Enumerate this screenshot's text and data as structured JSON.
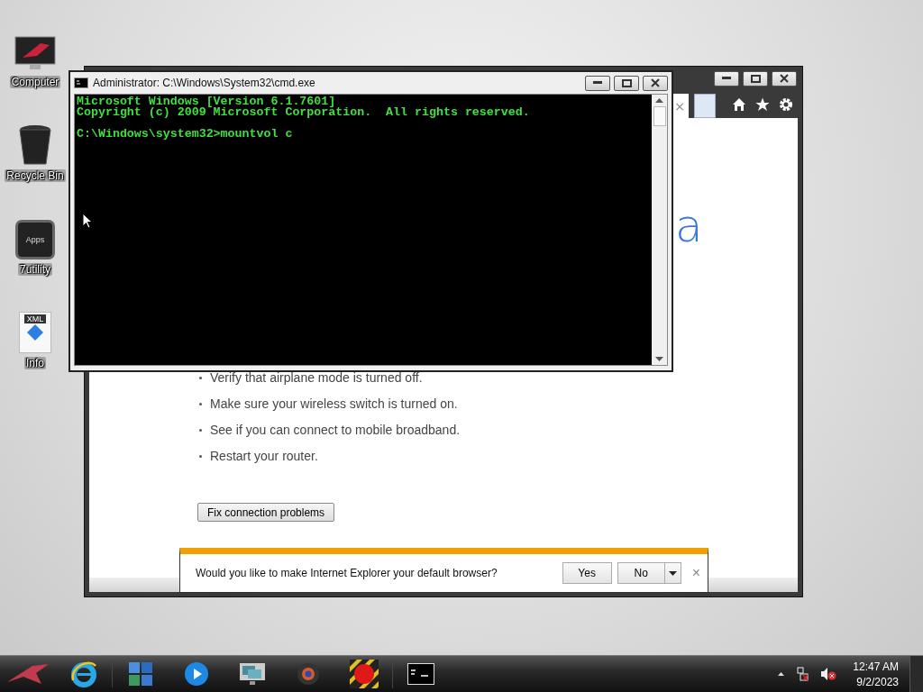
{
  "desktop_icons": [
    {
      "kind": "computer",
      "label": "Computer"
    },
    {
      "kind": "recycle",
      "label": "Recycle Bin"
    },
    {
      "kind": "apps",
      "label": "7utility",
      "badge": "Apps"
    },
    {
      "kind": "xml",
      "label": "Info",
      "badge": "XML"
    }
  ],
  "browser_window": {
    "tab_close": "×",
    "heading_fragment": "a",
    "bullets": [
      "Verify that airplane mode is turned off.",
      "Make sure your wireless switch is turned on.",
      "See if you can connect to mobile broadband.",
      "Restart your router."
    ],
    "fix_button": "Fix connection problems",
    "notification": {
      "message": "Would you like to make Internet Explorer your default browser?",
      "yes": "Yes",
      "no": "No",
      "close": "×"
    }
  },
  "cmd_window": {
    "title": "Administrator: C:\\Windows\\System32\\cmd.exe",
    "lines": [
      "Microsoft Windows [Version 6.1.7601]",
      "Copyright (c) 2009 Microsoft Corporation.  All rights reserved."
    ],
    "prompt": "C:\\Windows\\system32>mountvol c"
  },
  "taskbar": {
    "apps": [
      {
        "kind": "start"
      },
      {
        "kind": "ie"
      },
      {
        "kind": "tiles"
      },
      {
        "kind": "media"
      },
      {
        "kind": "display"
      },
      {
        "kind": "camera"
      },
      {
        "kind": "record"
      },
      {
        "kind": "cmd"
      }
    ],
    "clock": {
      "time": "12:47 AM",
      "date": "9/2/2023"
    }
  }
}
